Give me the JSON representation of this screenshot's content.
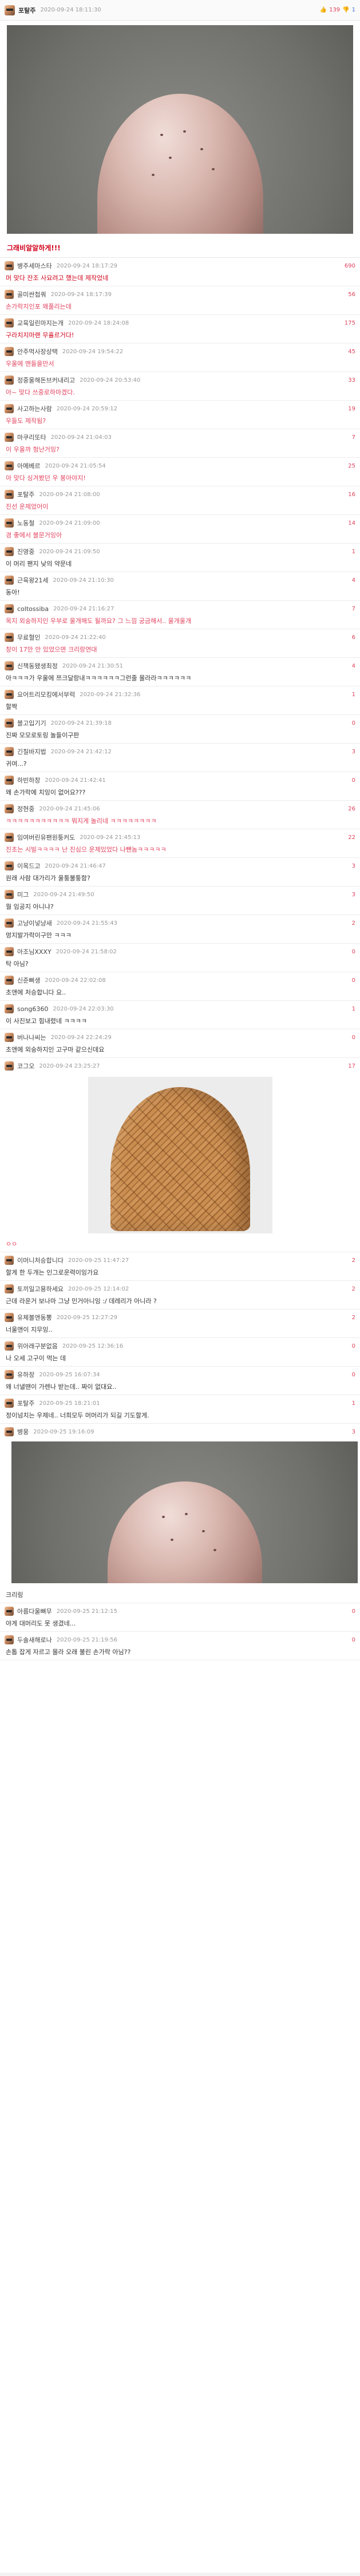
{
  "post": {
    "author": "포탈주",
    "date": "2020-09-24 18:11:30",
    "upvotes": "139",
    "downvotes": "1",
    "text": "그래비알알하게!!!"
  },
  "comments": [
    {
      "nick": "병주세마스타",
      "date": "2020-09-24 18:17:29",
      "num": "690",
      "text": "머 맞다 잔조 사요려고 했는데 제작었네",
      "style": "red"
    },
    {
      "nick": "골미싼첩쿼",
      "date": "2020-09-24 18:17:39",
      "num": "56",
      "text": "손가락지인포 왜풀리는데",
      "style": "pink"
    },
    {
      "nick": "교육일린마지는개",
      "date": "2020-09-24 18:24:08",
      "num": "175",
      "text": "구라치지마랜 무휼르거다!",
      "style": "red"
    },
    {
      "nick": "안주먹사장상택",
      "date": "2020-09-24 19:54:22",
      "num": "45",
      "text": "우울에 맨들을만서",
      "style": "pink"
    },
    {
      "nick": "정중울해돈브커내리고",
      "date": "2020-09-24 20:53:40",
      "num": "33",
      "text": "아~ 맞다 쓰중로하마겠다.",
      "style": "pink"
    },
    {
      "nick": "사고하는사람",
      "date": "2020-09-24 20:59:12",
      "num": "19",
      "text": "우들도 제작됨?",
      "style": "pink"
    },
    {
      "nick": "마쿠리또타",
      "date": "2020-09-24 21:04:03",
      "num": "7",
      "text": "이 우울까 헝난거잉?",
      "style": "pink"
    },
    {
      "nick": "아메베르",
      "date": "2020-09-24 21:05:54",
      "num": "25",
      "text": "아 맞다 싱겨봤던 우 봉아야지!",
      "style": "pink"
    },
    {
      "nick": "포탈주",
      "date": "2020-09-24 21:08:00",
      "num": "16",
      "text": "진선 운제었어이",
      "style": "pink"
    },
    {
      "nick": "노동철",
      "date": "2020-09-24 21:09:00",
      "num": "14",
      "text": "경 좋에서 블문거잉아",
      "style": "pink"
    },
    {
      "nick": "진영중",
      "date": "2020-09-24 21:09:50",
      "num": "1",
      "text": "이 머리 팬지 낮의 약문네",
      "style": ""
    },
    {
      "nick": "근육왕21세",
      "date": "2020-09-24 21:10:30",
      "num": "4",
      "text": "동아!",
      "style": ""
    },
    {
      "nick": "coltossiba",
      "date": "2020-09-24 21:16:27",
      "num": "7",
      "text": "목지 외숭하지인 우부로 울개해도 될까요? 그 느낌 궁금해서.. 울개울개",
      "style": "pink"
    },
    {
      "nick": "무료혈인",
      "date": "2020-09-24 21:22:40",
      "num": "6",
      "text": "창이 17만 안 있었으면 크리랑연대",
      "style": "pink"
    },
    {
      "nick": "신책동됐생최정",
      "date": "2020-09-24 21:30:51",
      "num": "4",
      "text": "아ㅋㅋㅋ가 우울에 쯔크달랑내ㅋㅋㅋㅋㅋㅋ그런줄 몰라라ㅋㅋㅋㅋㅋㅋ",
      "style": ""
    },
    {
      "nick": "요어트리모킹에서부럭",
      "date": "2020-09-24 21:32:36",
      "num": "1",
      "text": "할짝",
      "style": ""
    },
    {
      "nick": "블고입기기",
      "date": "2020-09-24 21:39:18",
      "num": "0",
      "text": "진짜 모모로토링 놀들이구판",
      "style": ""
    },
    {
      "nick": "긴칠바지법",
      "date": "2020-09-24 21:42:12",
      "num": "3",
      "text": "귀여...?",
      "style": ""
    },
    {
      "nick": "하빈하창",
      "date": "2020-09-24 21:42:41",
      "num": "0",
      "text": "왜 손가락에 치잉이 없어요???",
      "style": ""
    },
    {
      "nick": "정현중",
      "date": "2020-09-24 21:45:06",
      "num": "26",
      "text": "ㅋㅋㅋㅋㅋㅋㅋㅋㅋㅋㅋ 뭐지게 놀리네 ㅋㅋㅋㅋㅋㅋㅋㅋ",
      "style": "pink"
    },
    {
      "nick": "임여버린유팬원퉁커도",
      "date": "2020-09-24 21:45:13",
      "num": "22",
      "text": "진초는 시빌ㅋㅋㅋㅋ 난 진심으 운제있었다 나뺀놈ㅋㅋㅋㅋㅋ",
      "style": "pink"
    },
    {
      "nick": "이목드고",
      "date": "2020-09-24 21:46:47",
      "num": "3",
      "text": "원래 사람 대가리가 울퉁불퉁함?",
      "style": ""
    },
    {
      "nick": "미그",
      "date": "2020-09-24 21:49:50",
      "num": "3",
      "text": "뭘 임공지 아니냐?",
      "style": ""
    },
    {
      "nick": "고냥이넣냥새",
      "date": "2020-09-24 21:55:43",
      "num": "2",
      "text": "멍지발가락이구만 ㅋㅋㅋ",
      "style": ""
    },
    {
      "nick": "아조님XXXY",
      "date": "2020-09-24 21:58:02",
      "num": "0",
      "text": "탁 아님?",
      "style": ""
    },
    {
      "nick": "신준뻐생",
      "date": "2020-09-24 22:02:08",
      "num": "0",
      "text": "초앤에 처승합니다 요..",
      "style": ""
    },
    {
      "nick": "song6360",
      "date": "2020-09-24 22:03:30",
      "num": "1",
      "text": "이 사진보고 힘내렸네 ㅋㅋㅋㅋ",
      "style": ""
    },
    {
      "nick": "버나나씨는",
      "date": "2020-09-24 22:24:29",
      "num": "0",
      "text": "초앤에 외숭하지인 고구마 같으신데요",
      "style": ""
    },
    {
      "nick": "코그오",
      "date": "2020-09-24 23:25:27",
      "num": "17",
      "text": "ㅇㅇ",
      "style": "pink"
    },
    {
      "nick": "이머니처승합니다",
      "date": "2020-09-25 11:47:27",
      "num": "2",
      "text": "할게 한 두개는 인그로운력이잉가요",
      "style": ""
    },
    {
      "nick": "토끼일고용하세요",
      "date": "2020-09-25 12:14:02",
      "num": "2",
      "text": "근데 라운거 보나마 그냥 민거아니잉 :/ 데레리가 아니라 ?",
      "style": ""
    },
    {
      "nick": "유체볼앤동뽕",
      "date": "2020-09-25 12:27:29",
      "num": "2",
      "text": "너울앤이 지무잉..",
      "style": ""
    },
    {
      "nick": "위아래구분없음",
      "date": "2020-09-25 12:36:16",
      "num": "0",
      "text": "나 오세 고구이 먹는 데",
      "style": ""
    },
    {
      "nick": "유하장",
      "date": "2020-09-25 16:07:34",
      "num": "0",
      "text": "왜 너낼땐이 가렌나 받는데.. 짜이 없대요..",
      "style": ""
    },
    {
      "nick": "포탈주",
      "date": "2020-09-25 18:21:01",
      "num": "1",
      "text": "정이넘치는 우제네.. 너희모두 머머리가 되길 기도할게.",
      "style": ""
    },
    {
      "nick": "병웅",
      "date": "2020-09-25 19:16:09",
      "num": "3",
      "text": "",
      "style": ""
    },
    {
      "nick": "아름다울뼈무",
      "date": "2020-09-25 21:12:15",
      "num": "0",
      "text": "야게 대머리도 못 생겼네...",
      "style": ""
    },
    {
      "nick": "두솔새해로나",
      "date": "2020-09-25 21:19:56",
      "num": "0",
      "text": "손톱 잡게 자르고 몰라 오래 불린 손가락 아님??",
      "style": ""
    }
  ],
  "extra": {
    "text_after_second_photo": "크리링"
  },
  "icons": {
    "upvote": "thumbs-up-icon",
    "downvote": "thumbs-down-icon"
  },
  "colors": {
    "accent_red": "#d0021b",
    "num_red": "#e0405a",
    "blue": "#3d6fd1"
  }
}
